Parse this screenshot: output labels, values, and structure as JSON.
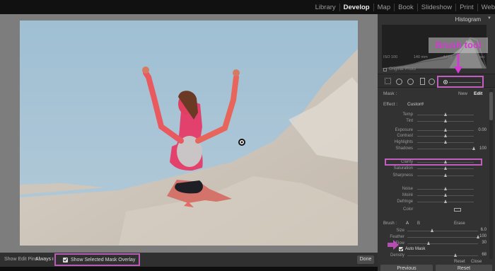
{
  "modules": {
    "library": "Library",
    "develop": "Develop",
    "map": "Map",
    "book": "Book",
    "slideshow": "Slideshow",
    "print": "Print",
    "web": "Web"
  },
  "annotation": {
    "callout": "Brush tool",
    "color": "#d33ad0",
    "box_color": "#c25ebf"
  },
  "panel": {
    "histogram_title": "Histogram",
    "hist_info": [
      "ISO 100",
      "140 mm",
      "f / 13",
      "1/320 sec"
    ],
    "original_photo": "Original Photo",
    "mask_label": "Mask :",
    "mask_new": "New",
    "mask_edit": "Edit",
    "effect_label": "Effect :",
    "effect_value": "Custom",
    "sliders": [
      {
        "label": "Temp",
        "value": "",
        "pos": 0.5
      },
      {
        "label": "Tint",
        "value": "",
        "pos": 0.5
      },
      {
        "label": "Exposure",
        "value": "0.00",
        "pos": 0.5
      },
      {
        "label": "Contrast",
        "value": "",
        "pos": 0.5
      },
      {
        "label": "Highlights",
        "value": "",
        "pos": 0.5
      },
      {
        "label": "Shadows",
        "value": "100",
        "pos": 1.0
      },
      {
        "label": "Clarity",
        "value": "",
        "pos": 0.5
      },
      {
        "label": "Saturation",
        "value": "",
        "pos": 0.5
      },
      {
        "label": "Sharpness",
        "value": "",
        "pos": 0.5
      },
      {
        "label": "Noise",
        "value": "",
        "pos": 0.5
      },
      {
        "label": "Moiré",
        "value": "",
        "pos": 0.5
      },
      {
        "label": "Defringe",
        "value": "",
        "pos": 0.5
      }
    ],
    "color_label": "Color",
    "brush_label": "Brush :",
    "brush_a": "A",
    "brush_b": "B",
    "brush_erase": "Erase",
    "brush_sliders": [
      {
        "label": "Size",
        "value": "6.0",
        "pos": 0.35
      },
      {
        "label": "Feather",
        "value": "100",
        "pos": 1.0
      },
      {
        "label": "Flow",
        "value": "30",
        "pos": 0.3
      }
    ],
    "auto_mask": "Auto Mask",
    "density": {
      "label": "Density",
      "value": "68",
      "pos": 0.68
    },
    "reset": "Reset",
    "close": "Close",
    "previous_button": "Previous",
    "reset_button": "Reset"
  },
  "toolbar": {
    "show_edit_pins": "Show Edit Pins :",
    "pins_value": "Always",
    "show_overlay": "Show Selected Mask Overlay",
    "done": "Done"
  }
}
